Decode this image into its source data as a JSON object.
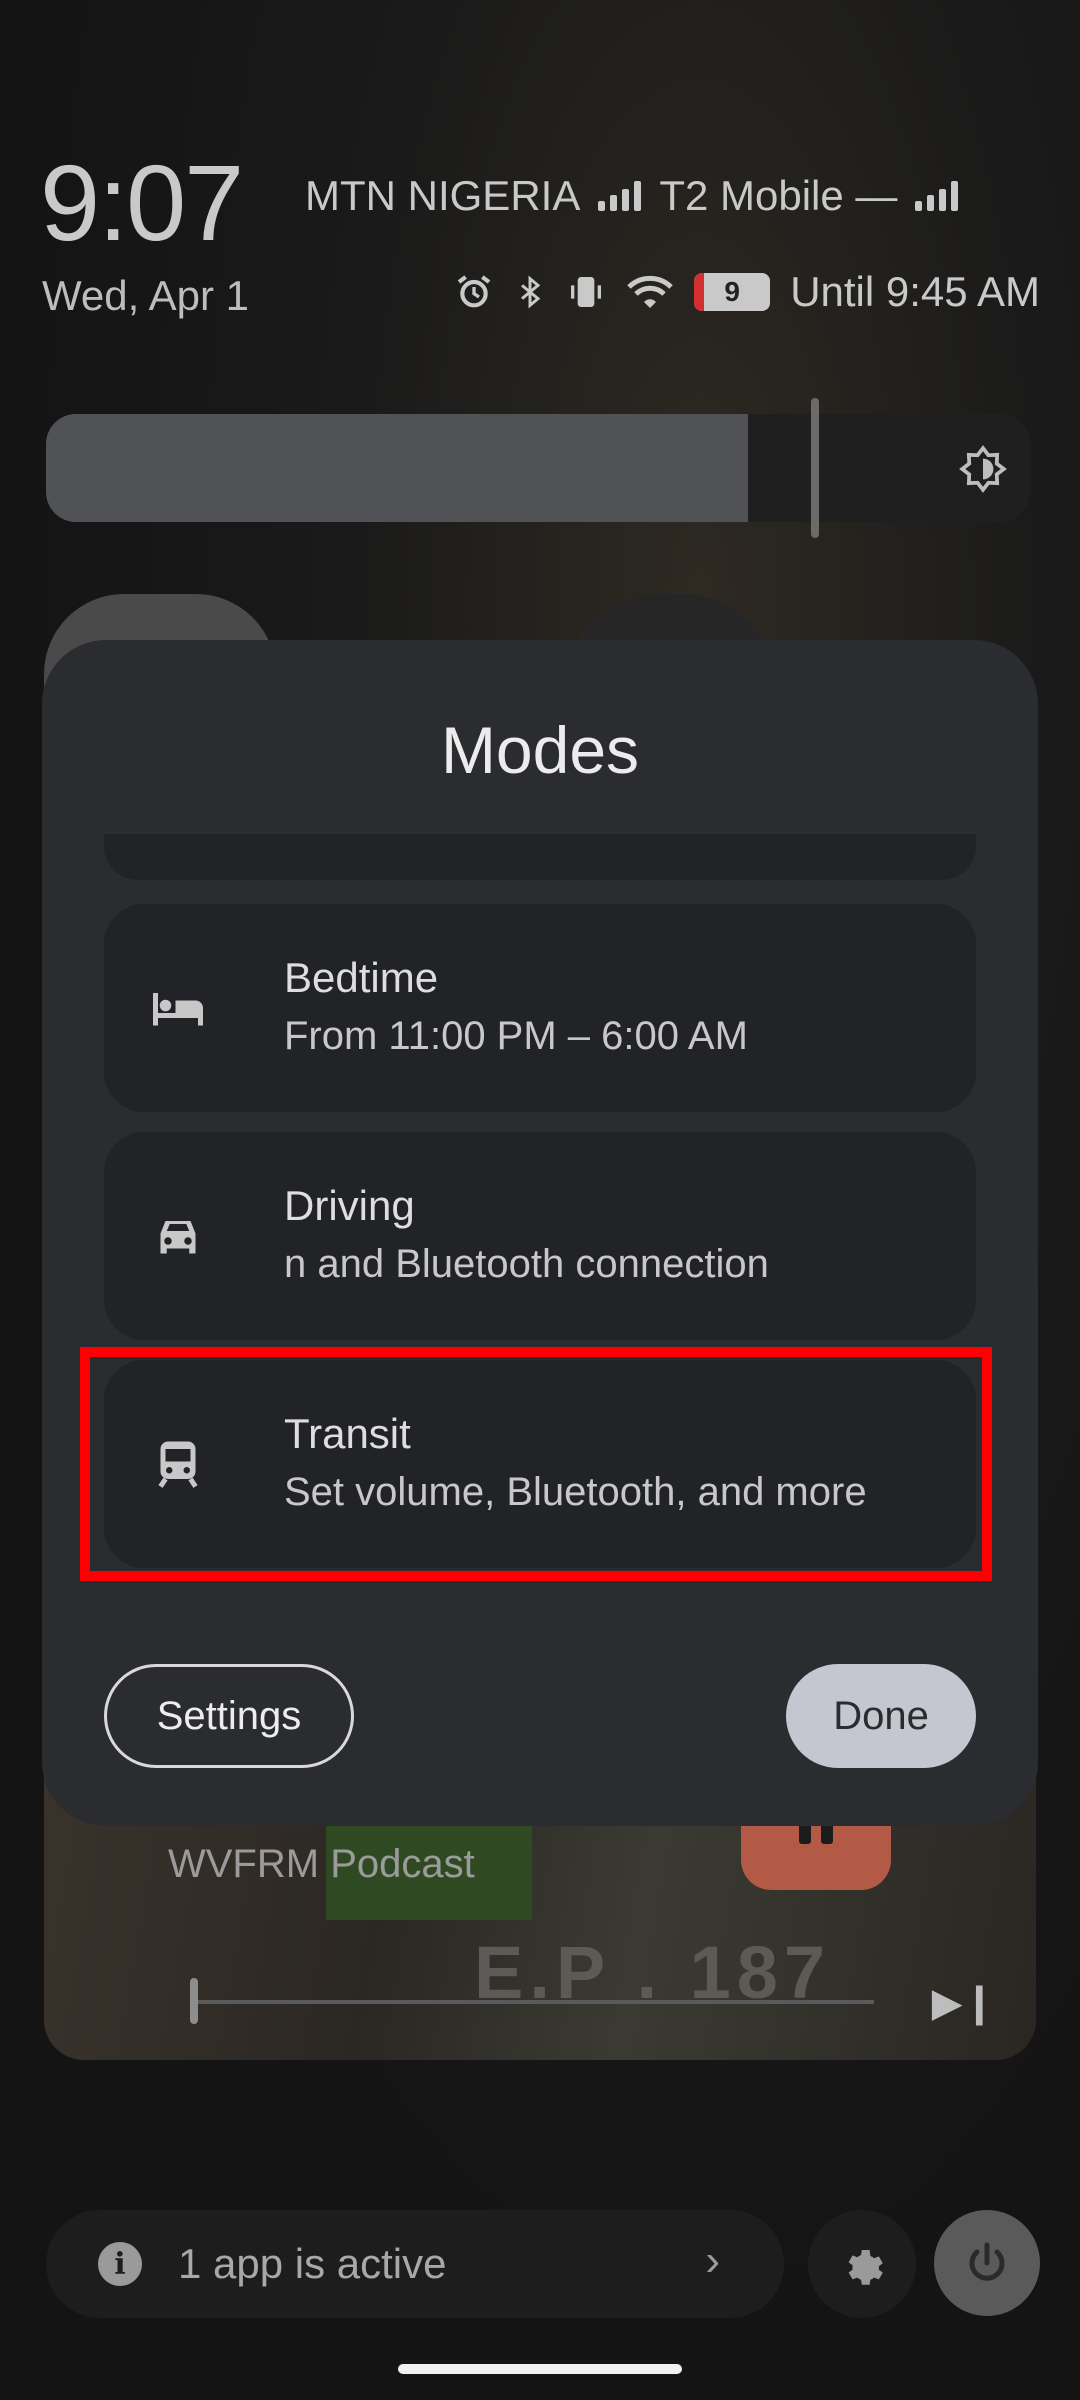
{
  "status": {
    "time": "9:07",
    "carrier1": "MTN NIGERIA",
    "carrier2": "T2 Mobile —",
    "date": "Wed, Apr 1",
    "battery_level": "9",
    "alarm_text": "Until 9:45 AM",
    "icons": [
      "alarm-icon",
      "bluetooth-icon",
      "vibrate-icon",
      "wifi-icon",
      "battery-icon"
    ]
  },
  "brightness": {
    "level": 0.72
  },
  "modes_sheet": {
    "title": "Modes",
    "modes": [
      {
        "name": "Bedtime",
        "description": "From 11:00 PM – 6:00 AM",
        "icon": "bed-icon"
      },
      {
        "name": "Driving",
        "description": "n and Bluetooth connection",
        "icon": "car-icon"
      },
      {
        "name": "Transit",
        "description": "Set volume, Bluetooth, and more",
        "icon": "train-icon"
      }
    ],
    "settings_label": "Settings",
    "done_label": "Done"
  },
  "media": {
    "source": "WVFRM Podcast",
    "episode": "E.P . 187"
  },
  "footer": {
    "active_apps_label": "1 app is active"
  },
  "colors": {
    "sheet": "#2b2c2f",
    "card": "#222326",
    "highlight": "#ff0000",
    "done_button": "#c4c7d0"
  }
}
